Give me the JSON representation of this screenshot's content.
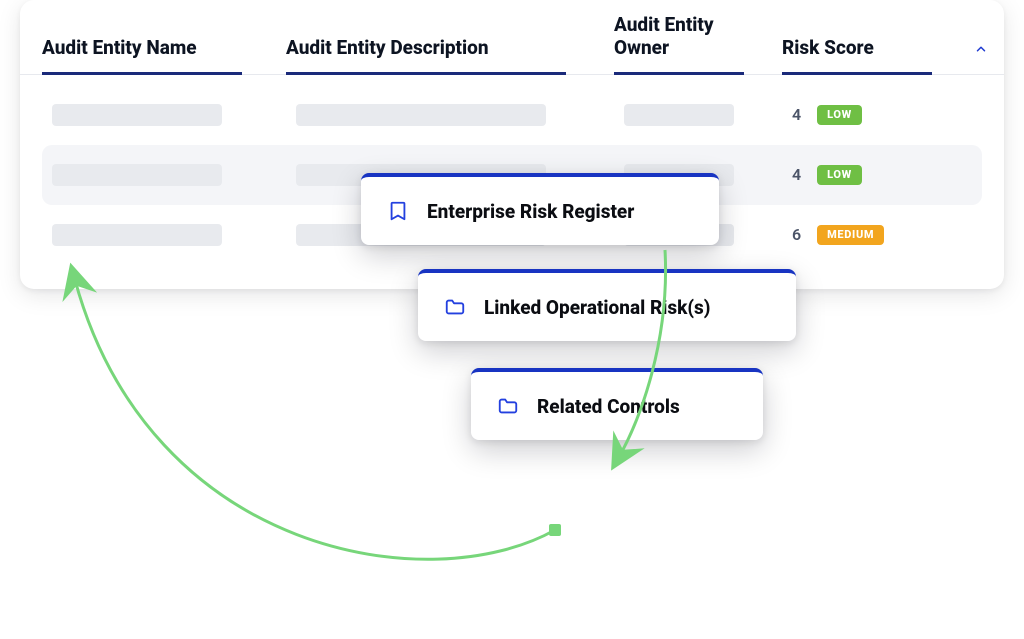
{
  "table": {
    "headers": {
      "name": "Audit Entity Name",
      "description": "Audit Entity Description",
      "owner": "Audit Entity Owner",
      "score": "Risk Score"
    },
    "rows": [
      {
        "score": 4,
        "score_label": "LOW",
        "score_level": "low"
      },
      {
        "score": 4,
        "score_label": "LOW",
        "score_level": "low"
      },
      {
        "score": 6,
        "score_label": "MEDIUM",
        "score_level": "medium"
      }
    ]
  },
  "popovers": {
    "p1": {
      "icon": "bookmark",
      "label": "Enterprise Risk Register"
    },
    "p2": {
      "icon": "folder",
      "label": "Linked Operational Risk(s)"
    },
    "p3": {
      "icon": "folder",
      "label": "Related Controls"
    }
  },
  "colors": {
    "indigo_underline": "#1a2a7a",
    "accent_blue": "#2340df",
    "badge_low": "#6fbf44",
    "badge_medium": "#f2a51e",
    "arrow_green": "#77d67a"
  }
}
